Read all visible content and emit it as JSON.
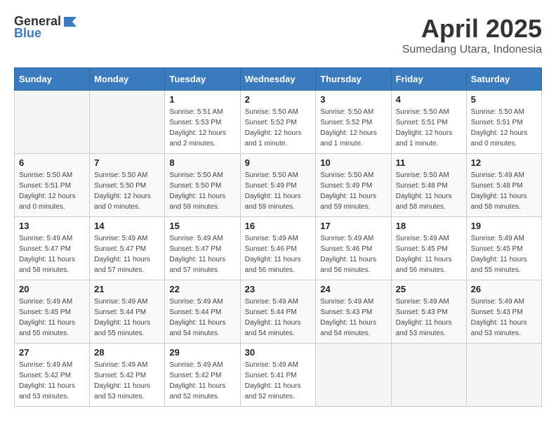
{
  "logo": {
    "general": "General",
    "blue": "Blue"
  },
  "header": {
    "month": "April 2025",
    "location": "Sumedang Utara, Indonesia"
  },
  "weekdays": [
    "Sunday",
    "Monday",
    "Tuesday",
    "Wednesday",
    "Thursday",
    "Friday",
    "Saturday"
  ],
  "weeks": [
    [
      {
        "day": "",
        "sunrise": "",
        "sunset": "",
        "daylight": ""
      },
      {
        "day": "",
        "sunrise": "",
        "sunset": "",
        "daylight": ""
      },
      {
        "day": "1",
        "sunrise": "Sunrise: 5:51 AM",
        "sunset": "Sunset: 5:53 PM",
        "daylight": "Daylight: 12 hours and 2 minutes."
      },
      {
        "day": "2",
        "sunrise": "Sunrise: 5:50 AM",
        "sunset": "Sunset: 5:52 PM",
        "daylight": "Daylight: 12 hours and 1 minute."
      },
      {
        "day": "3",
        "sunrise": "Sunrise: 5:50 AM",
        "sunset": "Sunset: 5:52 PM",
        "daylight": "Daylight: 12 hours and 1 minute."
      },
      {
        "day": "4",
        "sunrise": "Sunrise: 5:50 AM",
        "sunset": "Sunset: 5:51 PM",
        "daylight": "Daylight: 12 hours and 1 minute."
      },
      {
        "day": "5",
        "sunrise": "Sunrise: 5:50 AM",
        "sunset": "Sunset: 5:51 PM",
        "daylight": "Daylight: 12 hours and 0 minutes."
      }
    ],
    [
      {
        "day": "6",
        "sunrise": "Sunrise: 5:50 AM",
        "sunset": "Sunset: 5:51 PM",
        "daylight": "Daylight: 12 hours and 0 minutes."
      },
      {
        "day": "7",
        "sunrise": "Sunrise: 5:50 AM",
        "sunset": "Sunset: 5:50 PM",
        "daylight": "Daylight: 12 hours and 0 minutes."
      },
      {
        "day": "8",
        "sunrise": "Sunrise: 5:50 AM",
        "sunset": "Sunset: 5:50 PM",
        "daylight": "Daylight: 11 hours and 59 minutes."
      },
      {
        "day": "9",
        "sunrise": "Sunrise: 5:50 AM",
        "sunset": "Sunset: 5:49 PM",
        "daylight": "Daylight: 11 hours and 59 minutes."
      },
      {
        "day": "10",
        "sunrise": "Sunrise: 5:50 AM",
        "sunset": "Sunset: 5:49 PM",
        "daylight": "Daylight: 11 hours and 59 minutes."
      },
      {
        "day": "11",
        "sunrise": "Sunrise: 5:50 AM",
        "sunset": "Sunset: 5:48 PM",
        "daylight": "Daylight: 11 hours and 58 minutes."
      },
      {
        "day": "12",
        "sunrise": "Sunrise: 5:49 AM",
        "sunset": "Sunset: 5:48 PM",
        "daylight": "Daylight: 11 hours and 58 minutes."
      }
    ],
    [
      {
        "day": "13",
        "sunrise": "Sunrise: 5:49 AM",
        "sunset": "Sunset: 5:47 PM",
        "daylight": "Daylight: 11 hours and 58 minutes."
      },
      {
        "day": "14",
        "sunrise": "Sunrise: 5:49 AM",
        "sunset": "Sunset: 5:47 PM",
        "daylight": "Daylight: 11 hours and 57 minutes."
      },
      {
        "day": "15",
        "sunrise": "Sunrise: 5:49 AM",
        "sunset": "Sunset: 5:47 PM",
        "daylight": "Daylight: 11 hours and 57 minutes."
      },
      {
        "day": "16",
        "sunrise": "Sunrise: 5:49 AM",
        "sunset": "Sunset: 5:46 PM",
        "daylight": "Daylight: 11 hours and 56 minutes."
      },
      {
        "day": "17",
        "sunrise": "Sunrise: 5:49 AM",
        "sunset": "Sunset: 5:46 PM",
        "daylight": "Daylight: 11 hours and 56 minutes."
      },
      {
        "day": "18",
        "sunrise": "Sunrise: 5:49 AM",
        "sunset": "Sunset: 5:45 PM",
        "daylight": "Daylight: 11 hours and 56 minutes."
      },
      {
        "day": "19",
        "sunrise": "Sunrise: 5:49 AM",
        "sunset": "Sunset: 5:45 PM",
        "daylight": "Daylight: 11 hours and 55 minutes."
      }
    ],
    [
      {
        "day": "20",
        "sunrise": "Sunrise: 5:49 AM",
        "sunset": "Sunset: 5:45 PM",
        "daylight": "Daylight: 11 hours and 55 minutes."
      },
      {
        "day": "21",
        "sunrise": "Sunrise: 5:49 AM",
        "sunset": "Sunset: 5:44 PM",
        "daylight": "Daylight: 11 hours and 55 minutes."
      },
      {
        "day": "22",
        "sunrise": "Sunrise: 5:49 AM",
        "sunset": "Sunset: 5:44 PM",
        "daylight": "Daylight: 11 hours and 54 minutes."
      },
      {
        "day": "23",
        "sunrise": "Sunrise: 5:49 AM",
        "sunset": "Sunset: 5:44 PM",
        "daylight": "Daylight: 11 hours and 54 minutes."
      },
      {
        "day": "24",
        "sunrise": "Sunrise: 5:49 AM",
        "sunset": "Sunset: 5:43 PM",
        "daylight": "Daylight: 11 hours and 54 minutes."
      },
      {
        "day": "25",
        "sunrise": "Sunrise: 5:49 AM",
        "sunset": "Sunset: 5:43 PM",
        "daylight": "Daylight: 11 hours and 53 minutes."
      },
      {
        "day": "26",
        "sunrise": "Sunrise: 5:49 AM",
        "sunset": "Sunset: 5:43 PM",
        "daylight": "Daylight: 11 hours and 53 minutes."
      }
    ],
    [
      {
        "day": "27",
        "sunrise": "Sunrise: 5:49 AM",
        "sunset": "Sunset: 5:42 PM",
        "daylight": "Daylight: 11 hours and 53 minutes."
      },
      {
        "day": "28",
        "sunrise": "Sunrise: 5:49 AM",
        "sunset": "Sunset: 5:42 PM",
        "daylight": "Daylight: 11 hours and 53 minutes."
      },
      {
        "day": "29",
        "sunrise": "Sunrise: 5:49 AM",
        "sunset": "Sunset: 5:42 PM",
        "daylight": "Daylight: 11 hours and 52 minutes."
      },
      {
        "day": "30",
        "sunrise": "Sunrise: 5:49 AM",
        "sunset": "Sunset: 5:41 PM",
        "daylight": "Daylight: 11 hours and 52 minutes."
      },
      {
        "day": "",
        "sunrise": "",
        "sunset": "",
        "daylight": ""
      },
      {
        "day": "",
        "sunrise": "",
        "sunset": "",
        "daylight": ""
      },
      {
        "day": "",
        "sunrise": "",
        "sunset": "",
        "daylight": ""
      }
    ]
  ]
}
